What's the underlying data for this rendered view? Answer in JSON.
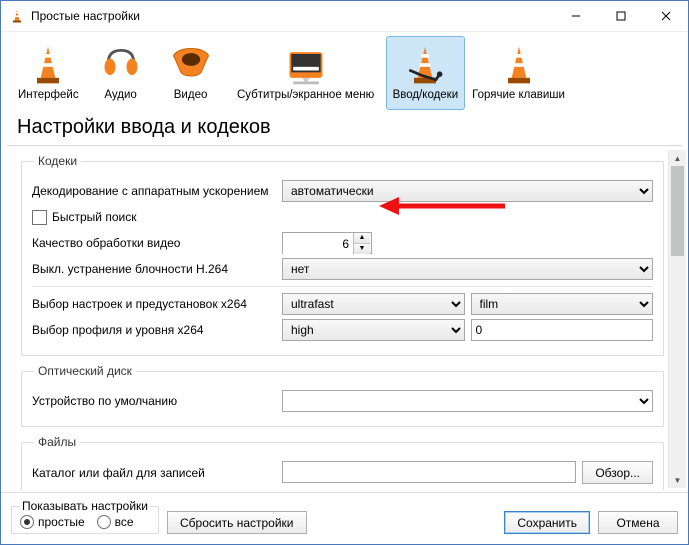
{
  "window": {
    "title": "Простые настройки"
  },
  "tabs": {
    "interface": "Интерфейс",
    "audio": "Аудио",
    "video": "Видео",
    "subs": "Субтитры/экранное меню",
    "input": "Ввод/кодеки",
    "hotkeys": "Горячие клавиши"
  },
  "heading": "Настройки ввода и кодеков",
  "groups": {
    "codecs": {
      "legend": "Кодеки",
      "hw_decode_label": "Декодирование с аппаратным ускорением",
      "hw_decode_value": "автоматически",
      "fast_seek_label": "Быстрый поиск",
      "quality_label": "Качество обработки видео",
      "quality_value": "6",
      "deblock_label": "Выкл. устранение блочности H.264",
      "deblock_value": "нет",
      "x264_preset_label": "Выбор настроек и предустановок x264",
      "x264_preset_value": "ultrafast",
      "x264_tune_value": "film",
      "x264_profile_label": "Выбор профиля и уровня x264",
      "x264_profile_value": "high",
      "x264_level_value": "0"
    },
    "optical": {
      "legend": "Оптический диск",
      "default_device_label": "Устройство по умолчанию",
      "default_device_value": ""
    },
    "files": {
      "legend": "Файлы",
      "record_label": "Каталог или файл для записей",
      "record_value": "",
      "browse": "Обзор..."
    }
  },
  "footer": {
    "show_settings_legend": "Показывать настройки",
    "simple_label": "простые",
    "all_label": "все",
    "reset_label": "Сбросить настройки",
    "save_label": "Сохранить",
    "cancel_label": "Отмена"
  }
}
